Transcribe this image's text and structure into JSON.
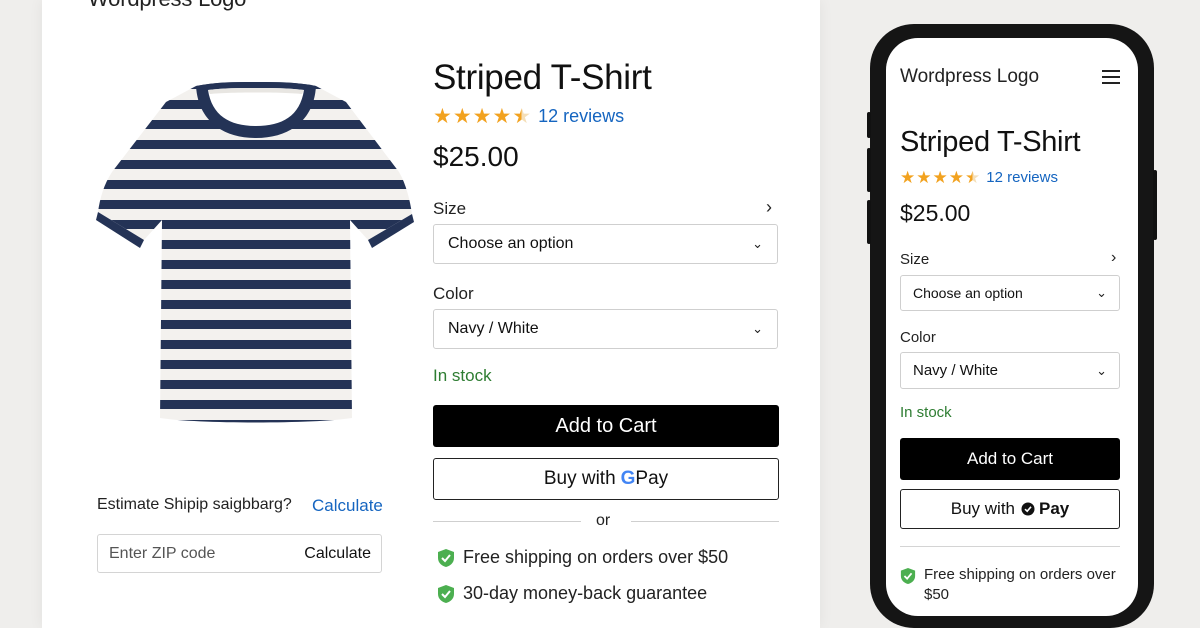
{
  "colors": {
    "accent_link": "#1565c0",
    "star": "#f2a21f",
    "in_stock": "#2e7d32",
    "primary_button": "#000000",
    "shield": "#4caf50"
  },
  "desktop": {
    "logo_text": "Wordpress Logo",
    "product": {
      "title": "Striped T-Shirt",
      "rating": 4.5,
      "reviews_label": "12 reviews",
      "price": "$25.00"
    },
    "size": {
      "label": "Size",
      "value": "Choose an option"
    },
    "color": {
      "label": "Color",
      "value": "Navy / White"
    },
    "stock_status": "In stock",
    "add_to_cart_label": "Add to Cart",
    "buy_with_label": "Buy with",
    "gpay_g": "G",
    "gpay_pay": "Pay",
    "or_label": "or",
    "features": [
      "Free shipping on orders over $50",
      "30-day money-back guarantee"
    ],
    "shipping": {
      "question": "Estimate Shipip saigbbarg?",
      "calculate_link": "Calculate",
      "zip_placeholder": "Enter ZIP code",
      "calculate_button": "Calculate"
    }
  },
  "mobile": {
    "logo_text": "Wordpress Logo",
    "menu_icon": "hamburger-menu-icon",
    "product": {
      "title": "Striped T-Shirt",
      "rating": 4.5,
      "reviews_label": "12 reviews",
      "price": "$25.00"
    },
    "size": {
      "label": "Size",
      "value": "Choose an option"
    },
    "color": {
      "label": "Color",
      "value": "Navy / White"
    },
    "stock_status": "In stock",
    "add_to_cart_label": "Add to Cart",
    "buy_with_label": "Buy with",
    "pay_label": "Pay",
    "features": [
      "Free shipping on orders over $50"
    ]
  }
}
